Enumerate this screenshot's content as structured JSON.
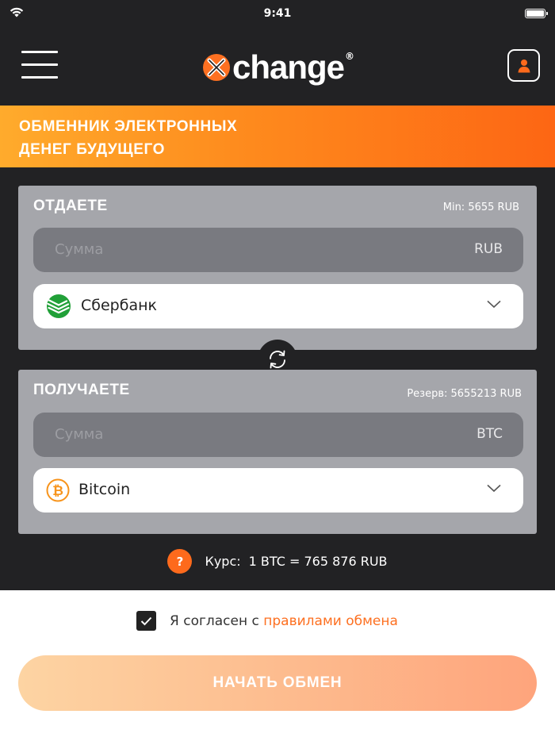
{
  "status_bar": {
    "time": "9:41"
  },
  "header": {
    "logo_text": "change",
    "logo_reg": "®",
    "menu_icon": "hamburger-icon",
    "profile_icon": "user-icon"
  },
  "banner": {
    "line1": "ОБМЕННИК ЭЛЕКТРОННЫХ",
    "line2": "ДЕНЕГ БУДУЩЕГО"
  },
  "give": {
    "title": "ОТДАЕТЕ",
    "min": "Min: 5655 RUB",
    "amount_placeholder": "Сумма",
    "currency": "RUB",
    "method": "Сбербанк",
    "method_icon": "sberbank-icon"
  },
  "receive": {
    "title": "ПОЛУЧАЕТЕ",
    "reserve": "Резерв: 5655213 RUB",
    "amount_placeholder": "Сумма",
    "currency": "BTC",
    "method": "Bitcoin",
    "method_icon": "bitcoin-icon"
  },
  "rate": {
    "help": "?",
    "label": "Курс:",
    "value": "1 BTC = 765 876 RUB"
  },
  "agreement": {
    "checked": true,
    "text": "Я согласен с ",
    "link": "правилами обмена"
  },
  "start_button": "НАЧАТЬ ОБМЕН",
  "colors": {
    "accent": "#fd6a1c",
    "dark_bg": "#222224",
    "card_bg": "#a5a6ab",
    "input_bg": "#797a80"
  }
}
